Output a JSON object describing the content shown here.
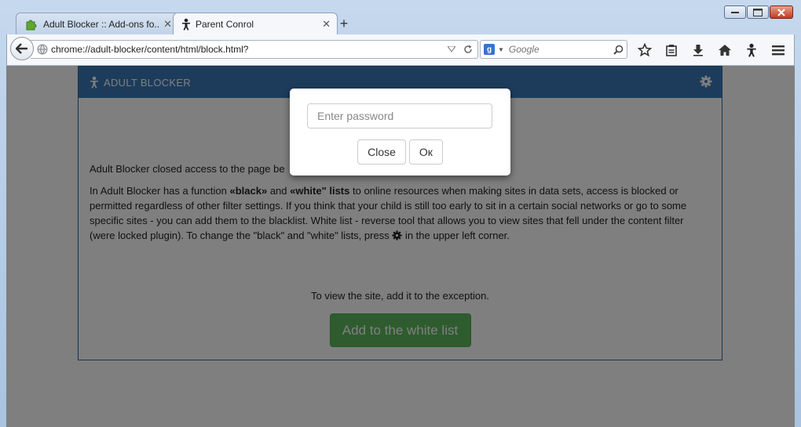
{
  "browser": {
    "tabs": [
      {
        "label": "Adult Blocker :: Add-ons fo...",
        "close": "✕",
        "active": false
      },
      {
        "label": "Parent Conrol",
        "close": "✕",
        "active": true
      }
    ],
    "new_tab": "+",
    "url": "chrome://adult-blocker/content/html/block.html?",
    "search": {
      "engine_badge": "g",
      "placeholder": "Google"
    }
  },
  "panel": {
    "title": "ADULT BLOCKER",
    "closed_text": "Adult Blocker closed access to the page be",
    "desc": {
      "part1": "In Adult Blocker has a function ",
      "black": "«black»",
      "part2": " and ",
      "white": "«white\" lists",
      "part3": " to online resources when making sites in data sets, access is blocked or permitted regardless of other filter settings. If you think that your child is still too early to sit in a certain social networks or go to some specific sites - you can add them to the blacklist. White list - reverse tool that allows you to view sites that fell under the content filter (were locked plugin). To change the \"black\" and \"white\" lists, press ",
      "part4": " in the upper left corner."
    },
    "exception_text": "To view the site, add it to the exception.",
    "add_button": "Add to the white list"
  },
  "modal": {
    "password_placeholder": "Enter password",
    "close_button": "Close",
    "ok_button": "Ок"
  },
  "colors": {
    "header_blue": "#3b79b8",
    "button_green": "#5cb85c"
  }
}
